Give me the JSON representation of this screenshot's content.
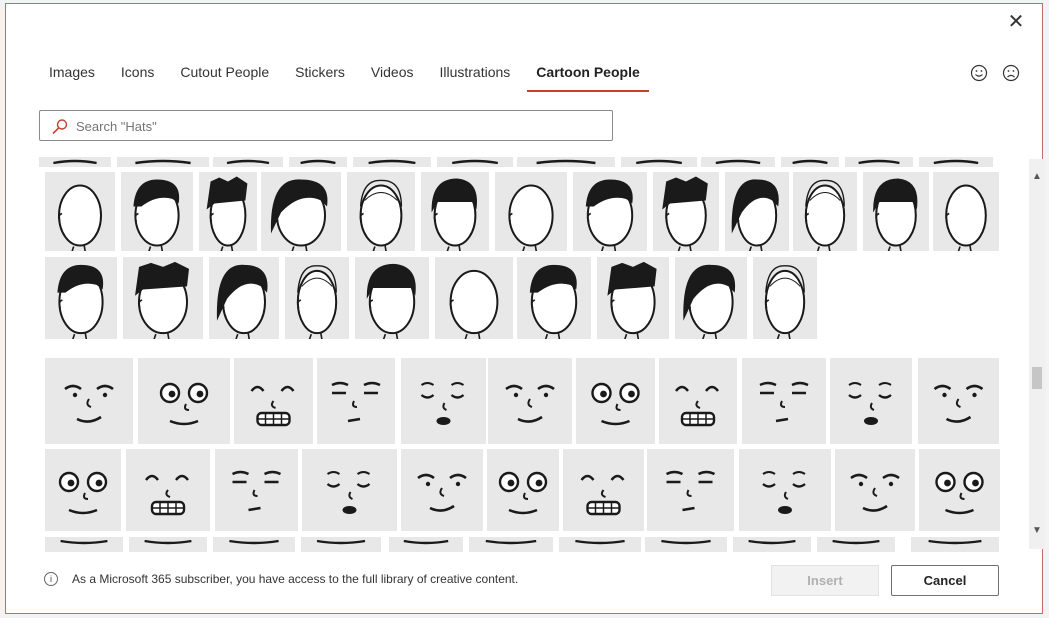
{
  "dialog": {
    "close_label": "✕"
  },
  "tabs": [
    {
      "label": "Images"
    },
    {
      "label": "Icons"
    },
    {
      "label": "Cutout People"
    },
    {
      "label": "Stickers"
    },
    {
      "label": "Videos"
    },
    {
      "label": "Illustrations"
    },
    {
      "label": "Cartoon People",
      "active": true
    }
  ],
  "feedback": {
    "happy_icon": "smiley-icon",
    "sad_icon": "frown-icon"
  },
  "search": {
    "placeholder": "Search \"Hats\"",
    "value": ""
  },
  "grid": {
    "sections": [
      "heads",
      "faces"
    ]
  },
  "footer": {
    "info_text": "As a Microsoft 365 subscriber, you have access to the full library of creative content.",
    "insert_label": "Insert",
    "cancel_label": "Cancel"
  },
  "colors": {
    "accent": "#c4422c",
    "tile_bg": "#e8e8e8",
    "ink": "#1a1a1a"
  }
}
